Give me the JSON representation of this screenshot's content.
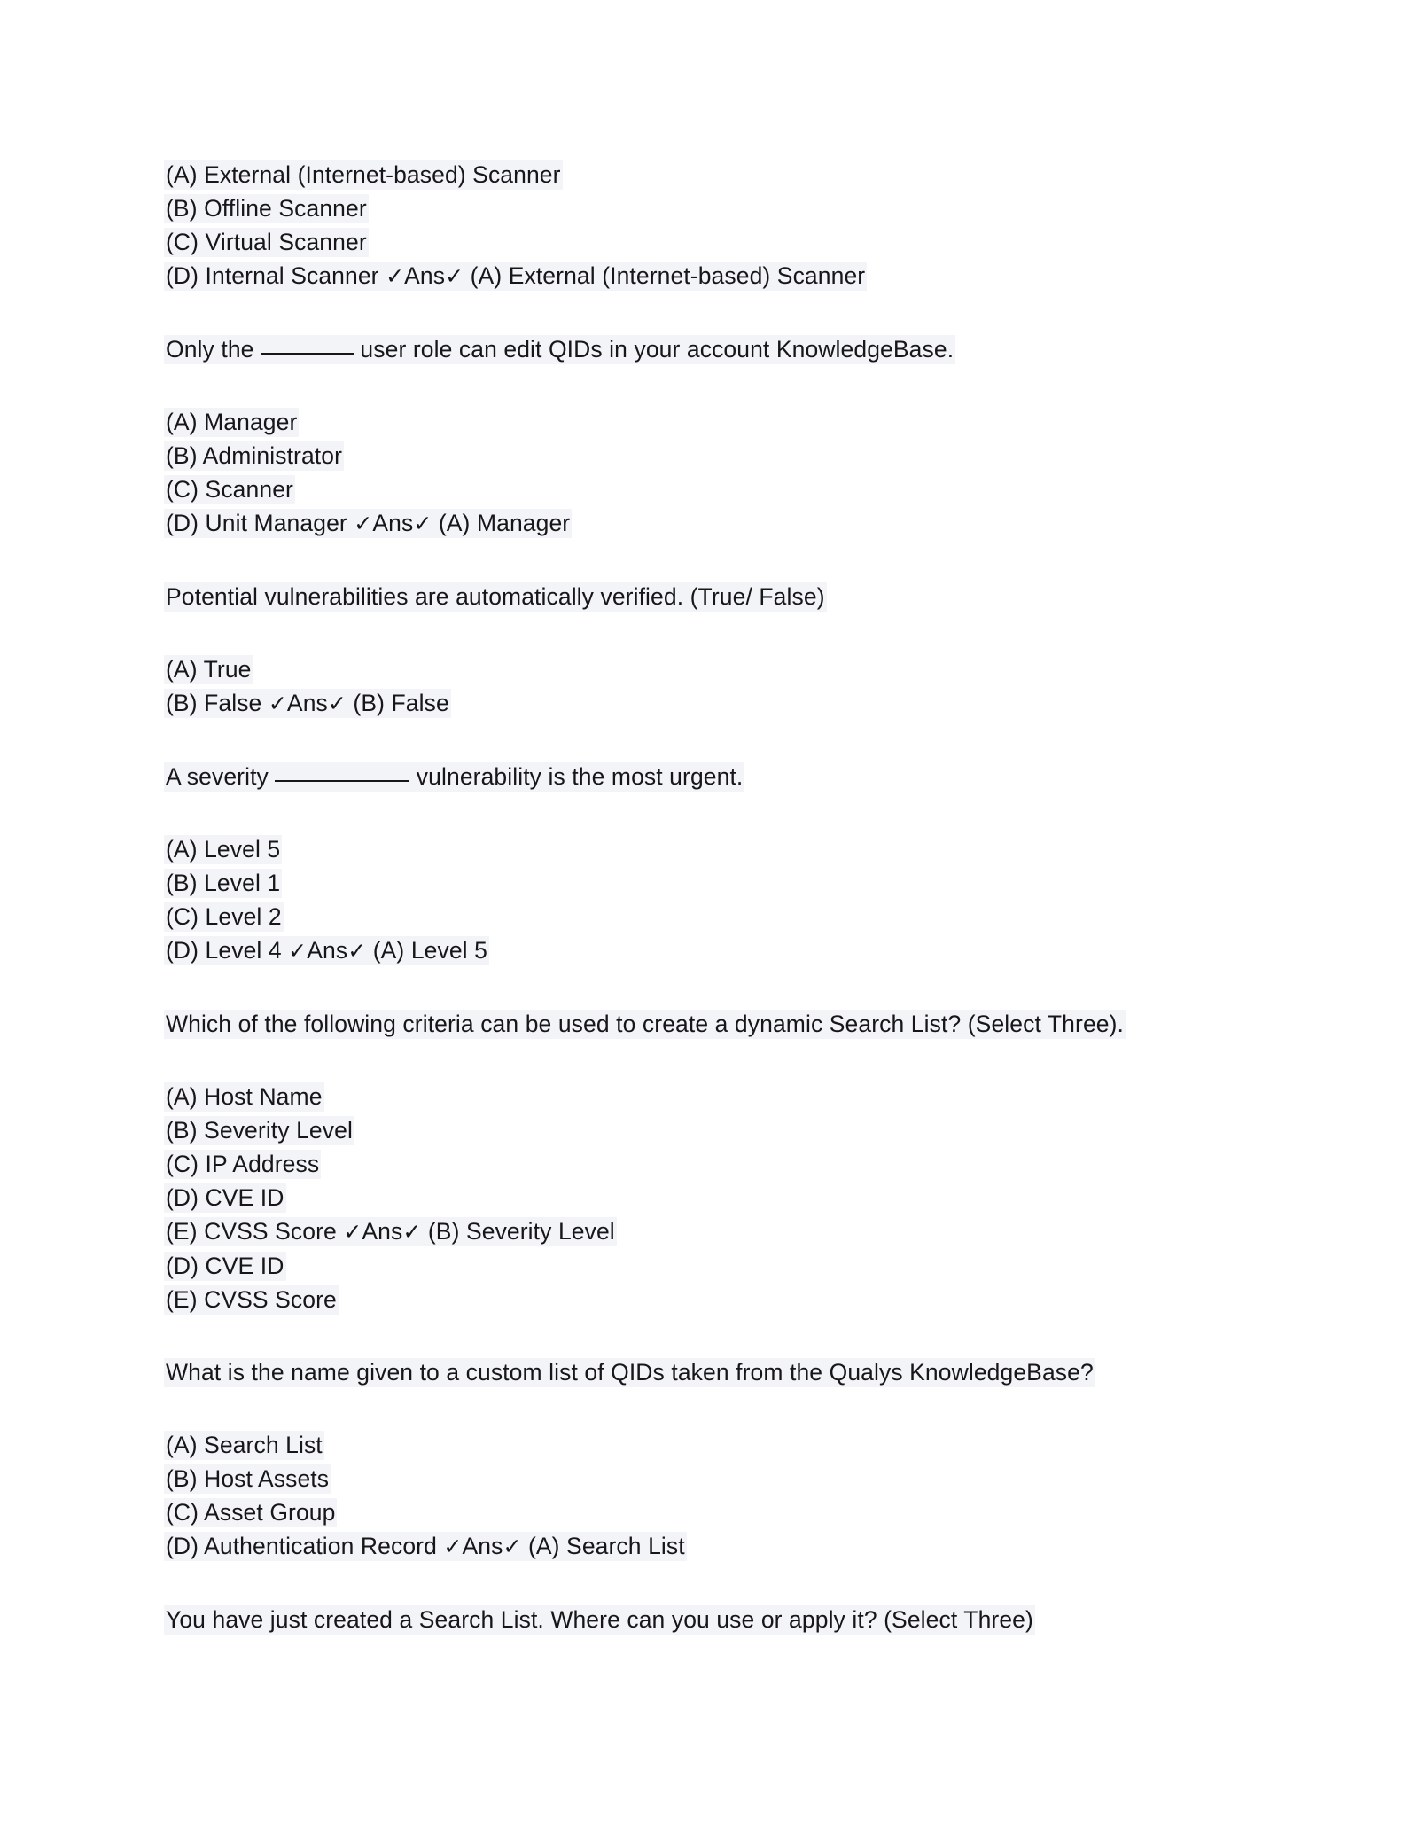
{
  "document": {
    "page_background": "#ffffff",
    "highlight_color": "#f3f4f7",
    "text_color": "#17171a",
    "answer_marker": {
      "check_glyph": "✓",
      "label": "Ans"
    }
  },
  "blocks": [
    {
      "type": "options",
      "lines": [
        {
          "text": "(A) External (Internet-based) Scanner"
        },
        {
          "text": "(B) Offline Scanner"
        },
        {
          "text": "(C) Virtual Scanner"
        },
        {
          "text": "(D) Internal Scanner ",
          "answer": true,
          "answer_text": " (A) External (Internet-based) Scanner"
        }
      ]
    },
    {
      "type": "question",
      "lines": [
        {
          "text_before": "Only the ",
          "blank": "w1",
          "text_after": " user role can edit QIDs in your account KnowledgeBase."
        }
      ]
    },
    {
      "type": "options",
      "lines": [
        {
          "text": "(A) Manager"
        },
        {
          "text": "(B) Administrator"
        },
        {
          "text": "(C) Scanner"
        },
        {
          "text": "(D) Unit Manager ",
          "answer": true,
          "answer_text": " (A) Manager"
        }
      ]
    },
    {
      "type": "question",
      "lines": [
        {
          "text": "Potential vulnerabilities are automatically verified. (True/ False)"
        }
      ]
    },
    {
      "type": "options",
      "lines": [
        {
          "text": "(A) True"
        },
        {
          "text": "(B) False ",
          "answer": true,
          "answer_text": " (B) False"
        }
      ]
    },
    {
      "type": "question",
      "lines": [
        {
          "text_before": "A severity ",
          "blank": "w2",
          "text_after": " vulnerability is the most urgent."
        }
      ]
    },
    {
      "type": "options",
      "lines": [
        {
          "text": "(A) Level 5"
        },
        {
          "text": "(B) Level 1"
        },
        {
          "text": "(C) Level 2"
        },
        {
          "text": "(D) Level 4 ",
          "answer": true,
          "answer_text": " (A) Level 5"
        }
      ]
    },
    {
      "type": "question",
      "lines": [
        {
          "text": "Which of the following criteria can be used to create a dynamic Search List? (Select Three)."
        }
      ]
    },
    {
      "type": "options",
      "lines": [
        {
          "text": "(A) Host Name"
        },
        {
          "text": "(B) Severity Level"
        },
        {
          "text": "(C) IP Address"
        },
        {
          "text": "(D) CVE ID"
        },
        {
          "text": "(E) CVSS Score ",
          "answer": true,
          "answer_text": " (B) Severity Level"
        },
        {
          "text": "(D) CVE ID"
        },
        {
          "text": "(E) CVSS Score"
        }
      ]
    },
    {
      "type": "question",
      "lines": [
        {
          "text": "What is the name given to a custom list of QIDs taken from the Qualys KnowledgeBase?"
        }
      ]
    },
    {
      "type": "options",
      "lines": [
        {
          "text": "(A) Search List"
        },
        {
          "text": "(B) Host Assets"
        },
        {
          "text": "(C) Asset Group"
        },
        {
          "text": "(D) Authentication Record ",
          "answer": true,
          "answer_text": " (A) Search List"
        }
      ]
    },
    {
      "type": "question",
      "lines": [
        {
          "text": "You have just created a Search List. Where can you use or apply it? (Select Three)"
        }
      ]
    }
  ]
}
